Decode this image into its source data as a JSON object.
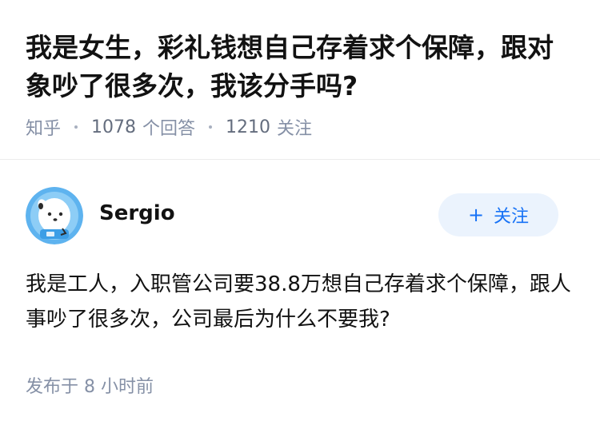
{
  "question": {
    "title": "我是女生，彩礼钱想自己存着求个保障，跟对象吵了很多次，我该分手吗?",
    "source": "知乎",
    "answers_count": "1078",
    "answers_label": "个回答",
    "followers_count": "1210",
    "followers_label": "关注"
  },
  "answer": {
    "author_name": "Sergio",
    "follow_label": "关注",
    "follow_icon": "plus-icon",
    "content": "我是工人，入职管公司要38.8万想自己存着求个保障，跟人事吵了很多次，公司最后为什么不要我?",
    "publish_time": "发布于 8 小时前"
  },
  "colors": {
    "accent": "#1772f6",
    "follow_bg": "#ebf3fd",
    "meta_text": "#8590a6",
    "avatar_bg": "#5eb3ef"
  }
}
